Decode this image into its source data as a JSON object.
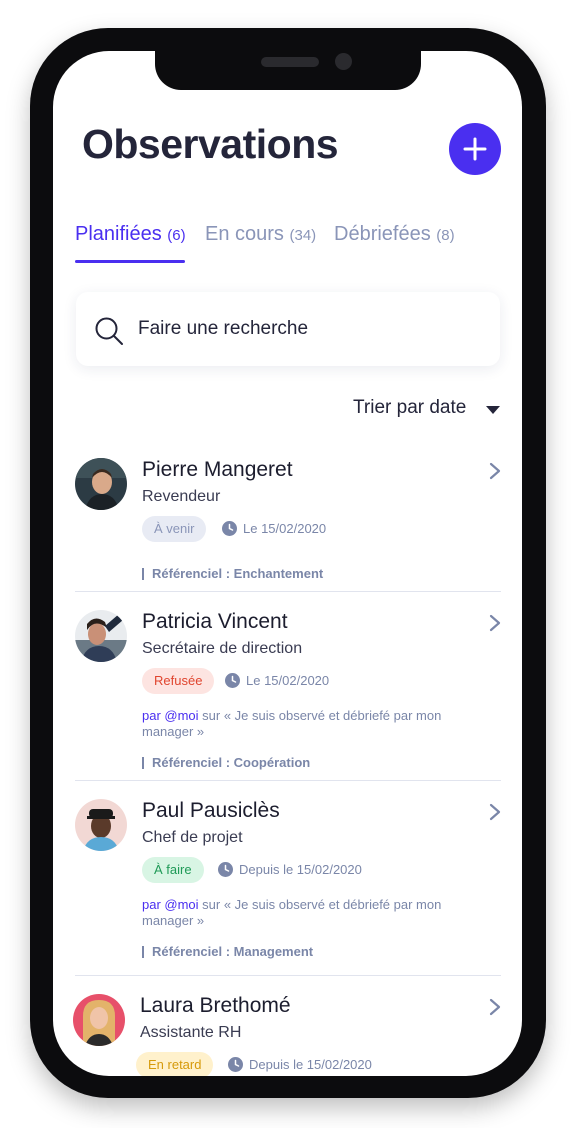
{
  "header": {
    "title": "Observations",
    "add_icon": "plus-icon"
  },
  "tabs": [
    {
      "label": "Planifiées",
      "count": "(6)",
      "active": true
    },
    {
      "label": "En cours",
      "count": "(34)",
      "active": false
    },
    {
      "label": "Débriefées",
      "count": "(8)",
      "active": false
    }
  ],
  "search": {
    "placeholder": "Faire une recherche",
    "icon": "search-icon"
  },
  "sort": {
    "label": "Trier par date",
    "icon": "caret-down-icon"
  },
  "colors": {
    "accent": "#4a2ff0",
    "text_dark": "#24253a",
    "muted": "#7a86a8",
    "badge_upcoming_bg": "#e8ebf4",
    "badge_upcoming_fg": "#8a95b8",
    "badge_refused_bg": "#fde4e1",
    "badge_refused_fg": "#e0452f",
    "badge_todo_bg": "#d8f5e4",
    "badge_todo_fg": "#1f9a57",
    "badge_late_bg": "#fff1cc",
    "badge_late_fg": "#d69a0b"
  },
  "observations": [
    {
      "name": "Pierre Mangeret",
      "role": "Revendeur",
      "status": "À venir",
      "date": "Le 15/02/2020",
      "by": "",
      "note": "",
      "referentiel": "Référenciel : Enchantement"
    },
    {
      "name": "Patricia Vincent",
      "role": "Secrétaire de direction",
      "status": "Refusée",
      "date": "Le 15/02/2020",
      "by": "par @moi",
      "note": " sur « Je suis observé et débriefé par mon manager »",
      "referentiel": "Référenciel : Coopération"
    },
    {
      "name": "Paul Pausiclès",
      "role": "Chef de projet",
      "status": "À faire",
      "date": "Depuis le 15/02/2020",
      "by": "par @moi",
      "note": " sur « Je suis observé et débriefé par mon manager »",
      "referentiel": "Référenciel : Management"
    },
    {
      "name": "Laura Brethomé",
      "role": "Assistante RH",
      "status": "En retard",
      "date": "Depuis le 15/02/2020",
      "by": "",
      "note": "",
      "referentiel": ""
    }
  ]
}
